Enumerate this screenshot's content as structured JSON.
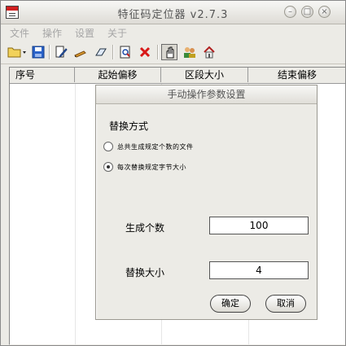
{
  "window": {
    "title": "特征码定位器 v2.7.3"
  },
  "menu": {
    "items": [
      "文件",
      "操作",
      "设置",
      "关于"
    ]
  },
  "toolbar": {
    "icons": [
      "open-folder-icon",
      "save-icon",
      "edit-icon",
      "pencil-icon",
      "eraser-icon",
      "search-doc-icon",
      "delete-icon",
      "hand-icon",
      "users-icon",
      "home-icon"
    ]
  },
  "table": {
    "columns": [
      "序号",
      "起始偏移",
      "区段大小",
      "结束偏移"
    ]
  },
  "dialog": {
    "title": "手动操作参数设置",
    "section_label": "替换方式",
    "radio_options": [
      "总共生成规定个数的文件",
      "每次替换规定字节大小"
    ],
    "selected_option": 1,
    "count_label": "生成个数",
    "count_value": "100",
    "size_label": "替换大小",
    "size_value": "4",
    "ok_label": "确定",
    "cancel_label": "取消"
  },
  "colors": {
    "accent_red": "#d02020",
    "window_bg": "#ecebe6"
  }
}
